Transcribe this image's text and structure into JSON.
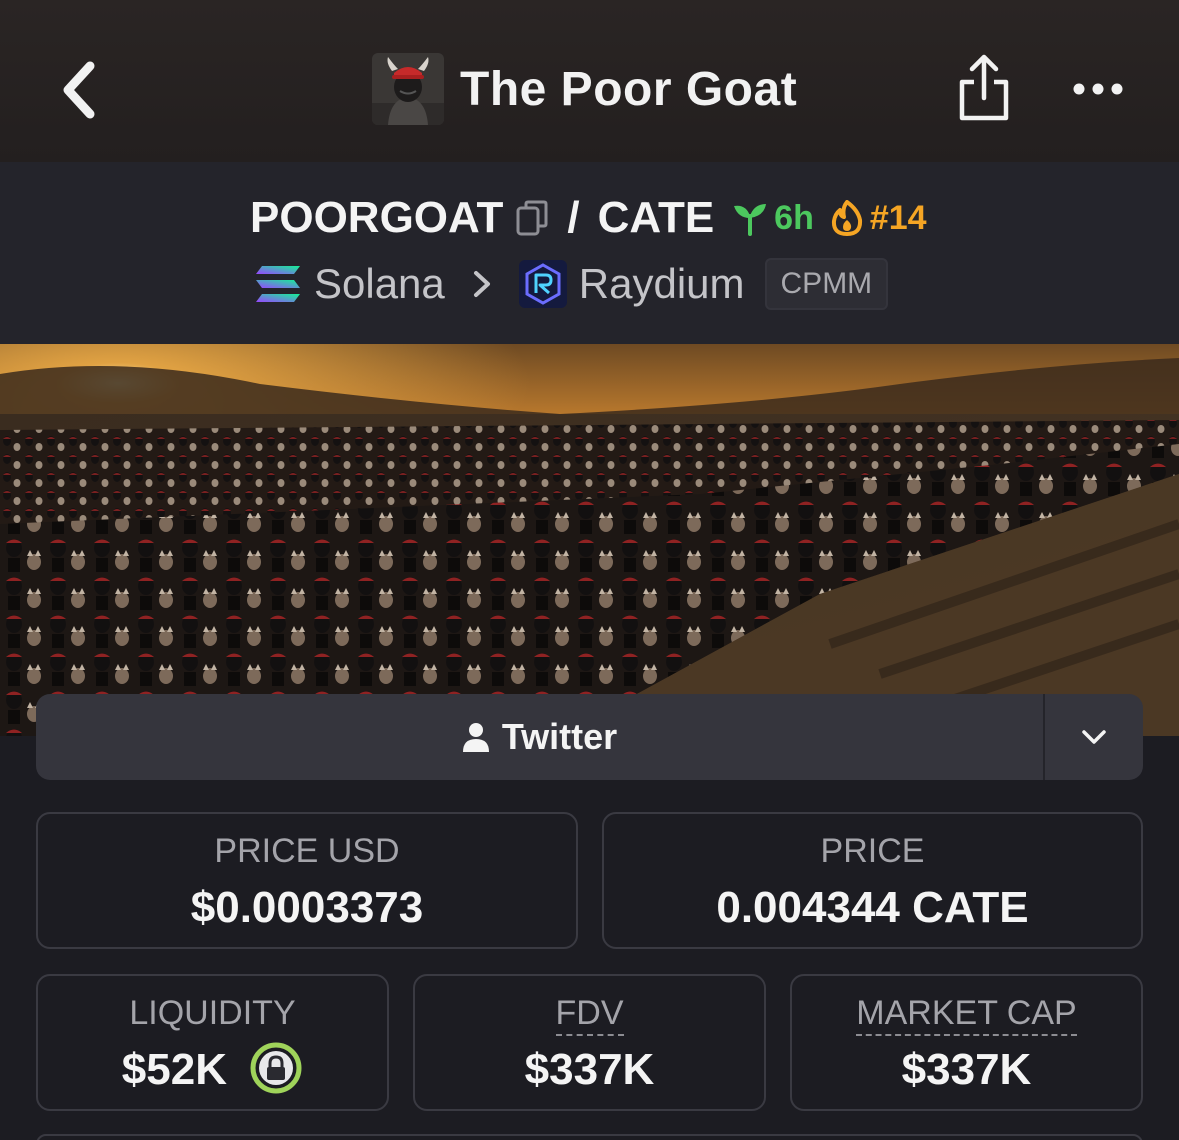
{
  "header": {
    "title": "The Poor Goat",
    "icons": {
      "back": "chevron-left-icon",
      "share": "share-icon",
      "more": "more-dots-icon"
    }
  },
  "pair": {
    "base": "POORGOAT",
    "separator": "/",
    "quote": "CATE",
    "age": "6h",
    "rank": "#14",
    "chain": "Solana",
    "dex": "Raydium",
    "dex_type": "CPMM",
    "colors": {
      "age": "#4cc85e",
      "rank": "#f5a524"
    }
  },
  "social": {
    "twitter_label": "Twitter"
  },
  "stats": {
    "price_usd": {
      "label": "PRICE USD",
      "value": "$0.0003373"
    },
    "price_native": {
      "label": "PRICE",
      "value": "0.004344 CATE"
    },
    "liquidity": {
      "label": "LIQUIDITY",
      "value": "$52K"
    },
    "fdv": {
      "label": "FDV",
      "value": "$337K"
    },
    "market_cap": {
      "label": "MARKET CAP",
      "value": "$337K"
    }
  }
}
